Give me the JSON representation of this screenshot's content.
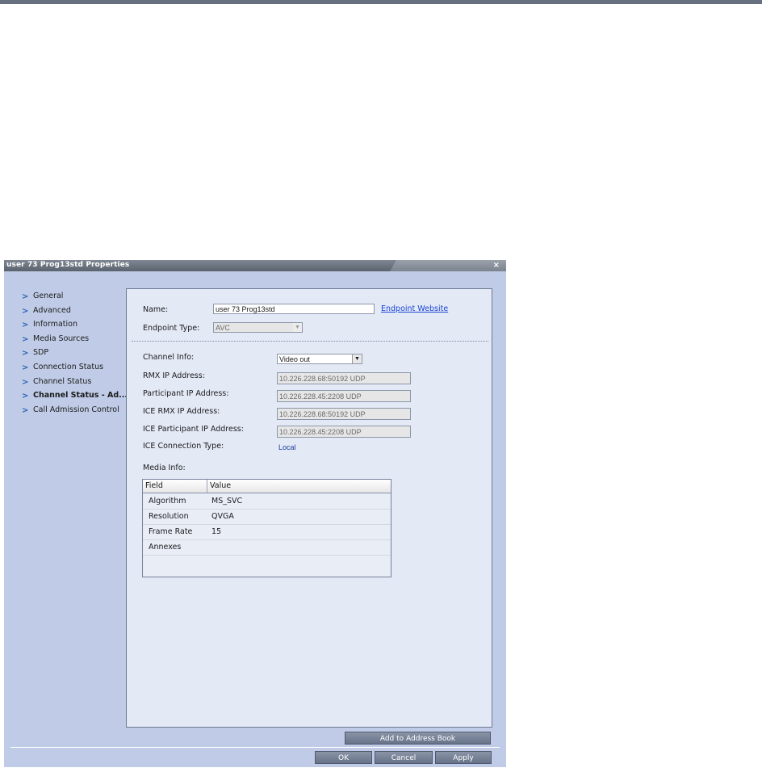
{
  "dialog": {
    "title": "user 73 Prog13std Properties",
    "close_label": "×"
  },
  "nav": {
    "items": [
      {
        "label": "General",
        "active": false
      },
      {
        "label": "Advanced",
        "active": false
      },
      {
        "label": "Information",
        "active": false
      },
      {
        "label": "Media Sources",
        "active": false
      },
      {
        "label": "SDP",
        "active": false
      },
      {
        "label": "Connection Status",
        "active": false
      },
      {
        "label": "Channel Status",
        "active": false
      },
      {
        "label": "Channel Status - Ad...",
        "active": true
      },
      {
        "label": "Call Admission Control",
        "active": false
      }
    ]
  },
  "form": {
    "name_label": "Name:",
    "name_value": "user 73 Prog13std",
    "endpoint_link": "Endpoint Website",
    "endpoint_type_label": "Endpoint Type:",
    "endpoint_type_value": "AVC",
    "channel_info_label": "Channel Info:",
    "channel_info_value": "Video out",
    "rmx_ip_label": "RMX IP Address:",
    "rmx_ip_value": "10.226.228.68:50192 UDP",
    "participant_ip_label": "Participant IP Address:",
    "participant_ip_value": "10.226.228.45:2208 UDP",
    "ice_rmx_ip_label": "ICE RMX IP Address:",
    "ice_rmx_ip_value": "10.226.228.68:50192 UDP",
    "ice_participant_ip_label": "ICE Participant IP Address:",
    "ice_participant_ip_value": "10.226.228.45:2208 UDP",
    "ice_connection_type_label": "ICE Connection Type:",
    "ice_connection_type_value": "Local",
    "media_info_label": "Media Info:"
  },
  "media_table": {
    "columns": [
      "Field",
      "Value"
    ],
    "rows": [
      {
        "field": "Algorithm",
        "value": "MS_SVC"
      },
      {
        "field": "Resolution",
        "value": "QVGA"
      },
      {
        "field": "Frame Rate",
        "value": "15"
      },
      {
        "field": "Annexes",
        "value": ""
      }
    ]
  },
  "buttons": {
    "add_to_address_book": "Add to Address Book",
    "ok": "OK",
    "cancel": "Cancel",
    "apply": "Apply"
  },
  "icons": {
    "nav_arrow": "chevron-right-icon",
    "close": "close-icon",
    "dropdown": "chevron-down-icon"
  }
}
